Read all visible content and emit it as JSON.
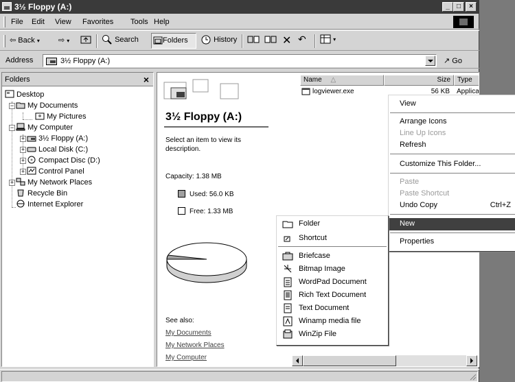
{
  "window": {
    "title": "3½ Floppy (A:)",
    "controls": {
      "minimize": "_",
      "maximize": "□",
      "close": "×"
    }
  },
  "menubar": {
    "items": [
      "File",
      "Edit",
      "View",
      "Favorites",
      "Tools",
      "Help"
    ]
  },
  "toolbar": {
    "back": "Back",
    "search": "Search",
    "folders": "Folders",
    "history": "History"
  },
  "address": {
    "label": "Address",
    "value": "3½ Floppy (A:)",
    "go": "Go"
  },
  "folders_pane": {
    "title": "Folders",
    "close": "×",
    "tree": [
      {
        "label": "Desktop",
        "icon": "desktop-icon"
      },
      {
        "label": "My Documents",
        "icon": "folder-icon"
      },
      {
        "label": "My Pictures",
        "icon": "pictures-icon"
      },
      {
        "label": "My Computer",
        "icon": "computer-icon"
      },
      {
        "label": "3½ Floppy (A:)",
        "icon": "floppy-icon"
      },
      {
        "label": "Local Disk (C:)",
        "icon": "harddisk-icon"
      },
      {
        "label": "Compact Disc (D:)",
        "icon": "cd-icon"
      },
      {
        "label": "Control Panel",
        "icon": "control-panel-icon"
      },
      {
        "label": "My Network Places",
        "icon": "network-icon"
      },
      {
        "label": "Recycle Bin",
        "icon": "recycle-bin-icon"
      },
      {
        "label": "Internet Explorer",
        "icon": "ie-icon"
      }
    ]
  },
  "content": {
    "title": "3½ Floppy (A:)",
    "description": "Select an item to view its description.",
    "capacity": "Capacity: 1.38 MB",
    "used": "Used: 56.0 KB",
    "free": "Free: 1.33 MB",
    "used_fraction": 0.04,
    "see_also": "See also:",
    "links": [
      "My Documents",
      "My Network Places",
      "My Computer"
    ]
  },
  "file_list": {
    "columns": [
      "Name",
      "Size",
      "Type"
    ],
    "rows": [
      {
        "name": "logviewer.exe",
        "size": "56 KB",
        "type": "Applica"
      }
    ]
  },
  "context_menu": {
    "items": [
      {
        "label": "View",
        "enabled": true
      },
      {
        "label": "Arrange Icons",
        "enabled": true
      },
      {
        "label": "Line Up Icons",
        "enabled": false
      },
      {
        "label": "Refresh",
        "enabled": true
      },
      {
        "label": "Customize This Folder...",
        "enabled": true
      },
      {
        "label": "Paste",
        "enabled": false
      },
      {
        "label": "Paste Shortcut",
        "enabled": false
      },
      {
        "label": "Undo Copy",
        "enabled": true,
        "shortcut": "Ctrl+Z"
      },
      {
        "label": "New",
        "enabled": true,
        "highlighted": true
      },
      {
        "label": "Properties",
        "enabled": true
      }
    ]
  },
  "new_submenu": {
    "items": [
      {
        "label": "Folder",
        "icon": "folder-icon"
      },
      {
        "label": "Shortcut",
        "icon": "shortcut-icon"
      },
      {
        "label": "Briefcase",
        "icon": "briefcase-icon"
      },
      {
        "label": "Bitmap Image",
        "icon": "bitmap-icon"
      },
      {
        "label": "WordPad Document",
        "icon": "wordpad-icon"
      },
      {
        "label": "Rich Text Document",
        "icon": "richtext-icon"
      },
      {
        "label": "Text Document",
        "icon": "text-document-icon"
      },
      {
        "label": "Winamp media file",
        "icon": "winamp-icon"
      },
      {
        "label": "WinZip File",
        "icon": "winzip-icon"
      }
    ]
  }
}
